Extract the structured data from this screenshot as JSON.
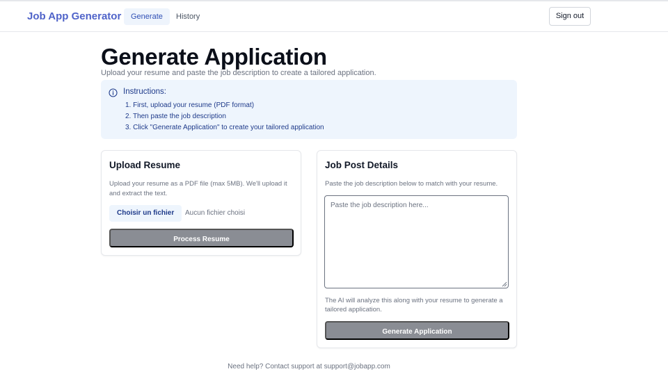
{
  "nav": {
    "brand": "Job App Generator",
    "tabs": [
      {
        "label": "Generate",
        "active": true
      },
      {
        "label": "History",
        "active": false
      }
    ],
    "sign_out": "Sign out"
  },
  "page": {
    "title": "Generate Application",
    "subtitle": "Upload your resume and paste the job description to create a tailored application."
  },
  "instructions": {
    "icon": "info-icon",
    "title": "Instructions:",
    "steps": [
      "1. First, upload your resume (PDF format)",
      "2. Then paste the job description",
      "3. Click \"Generate Application\" to create your tailored application"
    ]
  },
  "upload_card": {
    "title": "Upload Resume",
    "description": "Upload your resume as a PDF file (max 5MB). We'll upload it and extract the text.",
    "file_button": "Choisir un fichier",
    "file_status": "Aucun fichier choisi",
    "action": "Process Resume"
  },
  "job_card": {
    "title": "Job Post Details",
    "description": "Paste the job description below to match with your resume.",
    "textarea_placeholder": "Paste the job description here...",
    "textarea_value": "",
    "hint": "The AI will analyze this along with your resume to generate a tailored application.",
    "action": "Generate Application"
  },
  "footer": {
    "text": "Need help? Contact support at support@jobapp.com"
  },
  "colors": {
    "brand": "#4f63c9",
    "active_tab_bg": "#eef4fc",
    "info_bg": "#eef5fd",
    "info_text": "#1e3a8a",
    "disabled_button": "#8a8d94"
  }
}
